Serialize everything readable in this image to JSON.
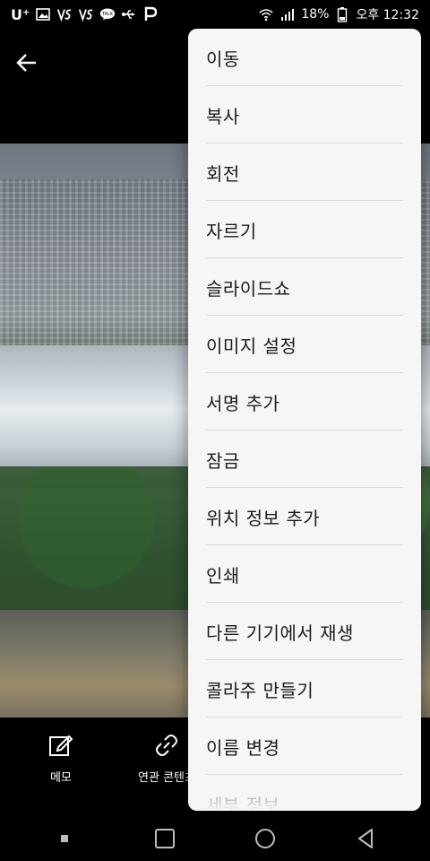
{
  "status_bar": {
    "carrier": "U⁺",
    "battery_percent": "18%",
    "time": "오후 12:32",
    "left_icons": [
      "image-icon",
      "vs-icon",
      "vs-icon",
      "talk-icon",
      "usb-icon",
      "p-icon"
    ],
    "right_icons": [
      "wifi-icon",
      "signal-icon",
      "battery-icon"
    ]
  },
  "photo": {
    "description": ""
  },
  "menu": {
    "items": [
      "이동",
      "복사",
      "회전",
      "자르기",
      "슬라이드쇼",
      "이미지 설정",
      "서명 추가",
      "잠금",
      "위치 정보 추가",
      "인쇄",
      "다른 기기에서 재생",
      "콜라주 만들기",
      "이름 변경",
      "세부 정보"
    ]
  },
  "bottom_actions": {
    "memo_label": "메모",
    "related_label": "연관 콘텐츠"
  },
  "navigation": {
    "buttons": [
      "dot-icon",
      "recent-icon",
      "home-icon",
      "back-icon"
    ]
  }
}
